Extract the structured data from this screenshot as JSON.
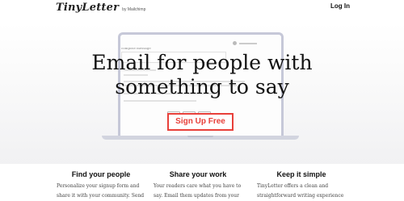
{
  "header": {
    "logo_main": "TinyLetter",
    "logo_sub": "by Mailchimp",
    "login_label": "Log In"
  },
  "hero": {
    "headline_line1": "Email for people with",
    "headline_line2": "something to say",
    "signup_label": "Sign Up Free",
    "accent_color": "#e8403a"
  },
  "laptop_screen": {
    "title": "compose message"
  },
  "features": [
    {
      "heading": "Find your people",
      "line1": "Personalize your signup form and",
      "line2": "share it with your community. Send"
    },
    {
      "heading": "Share your work",
      "line1": "Your readers care what you have to",
      "line2": "say. Email them updates from your"
    },
    {
      "heading": "Keep it simple",
      "line1": "TinyLetter offers a clean and",
      "line2": "straightforward writing experience"
    }
  ]
}
